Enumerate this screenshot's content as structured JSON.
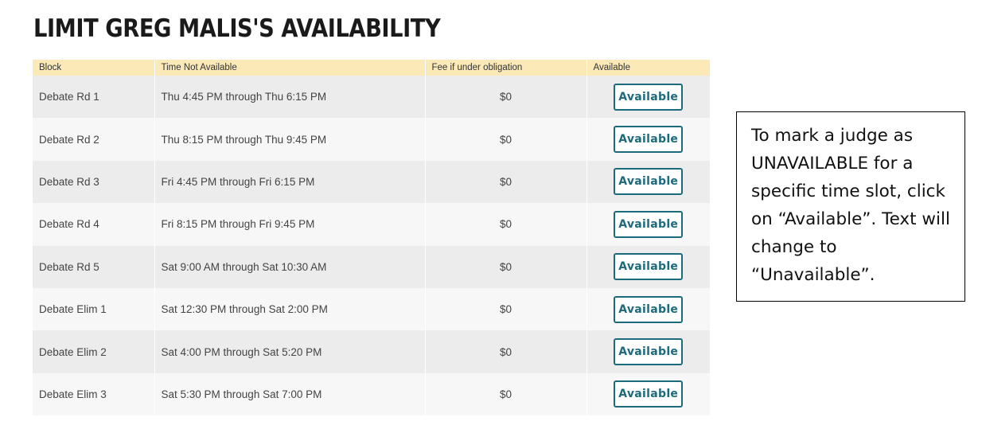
{
  "page": {
    "title": "LIMIT GREG MALIS'S AVAILABILITY"
  },
  "table": {
    "headers": {
      "block": "Block",
      "time": "Time Not Available",
      "fee": "Fee if under obligation",
      "available": "Available"
    },
    "rows": [
      {
        "block": "Debate Rd 1",
        "time": "Thu 4:45 PM through Thu 6:15 PM",
        "fee": "$0",
        "status": "Available"
      },
      {
        "block": "Debate Rd 2",
        "time": "Thu 8:15 PM through Thu 9:45 PM",
        "fee": "$0",
        "status": "Available"
      },
      {
        "block": "Debate Rd 3",
        "time": "Fri 4:45 PM through Fri 6:15 PM",
        "fee": "$0",
        "status": "Available"
      },
      {
        "block": "Debate Rd 4",
        "time": "Fri 8:15 PM through Fri 9:45 PM",
        "fee": "$0",
        "status": "Available"
      },
      {
        "block": "Debate Rd 5",
        "time": "Sat 9:00 AM through Sat 10:30 AM",
        "fee": "$0",
        "status": "Available"
      },
      {
        "block": "Debate Elim 1",
        "time": "Sat 12:30 PM through Sat 2:00 PM",
        "fee": "$0",
        "status": "Available"
      },
      {
        "block": "Debate Elim 2",
        "time": "Sat 4:00 PM through Sat 5:20 PM",
        "fee": "$0",
        "status": "Available"
      },
      {
        "block": "Debate Elim 3",
        "time": "Sat 5:30 PM through Sat 7:00 PM",
        "fee": "$0",
        "status": "Available"
      }
    ]
  },
  "callout": {
    "text": "To mark a judge as UNAVAILABLE for a specific time slot, click on “Available”. Text will change to “Unavailable”."
  },
  "colors": {
    "header_bg": "#fbe9b7",
    "button_accent": "#1c6b7d",
    "row_odd": "#ececec",
    "row_even": "#f7f7f7"
  }
}
